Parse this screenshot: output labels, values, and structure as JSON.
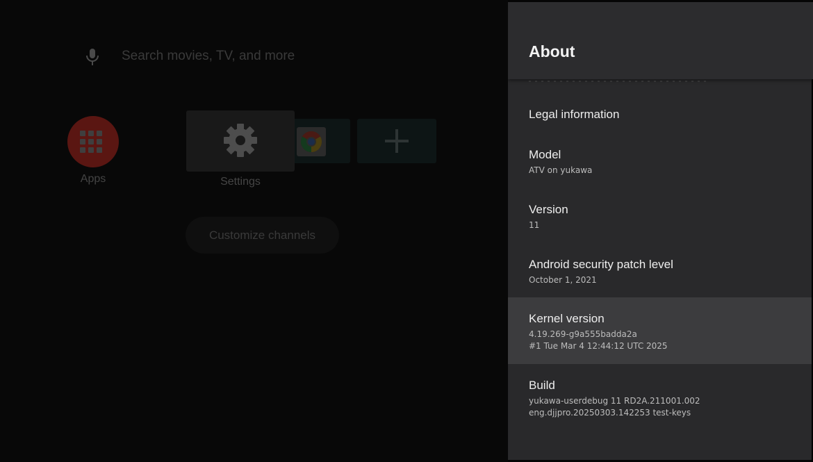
{
  "home": {
    "search_placeholder": "Search movies, TV, and more",
    "apps_label": "Apps",
    "settings_label": "Settings",
    "customize_label": "Customize channels",
    "icons": {
      "mic": "microphone-icon",
      "apps": "grid-icon",
      "settings": "gear-icon",
      "chrome": "chrome-icon",
      "add": "plus-icon"
    }
  },
  "panel": {
    "title": "About",
    "items": [
      {
        "title": "Legal information",
        "subtitle": ""
      },
      {
        "title": "Model",
        "subtitle": "ATV on yukawa"
      },
      {
        "title": "Version",
        "subtitle": "11"
      },
      {
        "title": "Android security patch level",
        "subtitle": "October 1, 2021"
      },
      {
        "title": "Kernel version",
        "subtitle": "4.19.269-g9a555badda2a\n#1 Tue Mar 4 12:44:12 UTC 2025"
      },
      {
        "title": "Build",
        "subtitle": "yukawa-userdebug 11 RD2A.211001.002\neng.djjpro.20250303.142253 test-keys"
      }
    ],
    "focused_item": "Kernel version"
  },
  "colors": {
    "panel_bg": "#29292b",
    "focused_bg": "#3c3c3e",
    "apps_red": "#5a1612"
  }
}
